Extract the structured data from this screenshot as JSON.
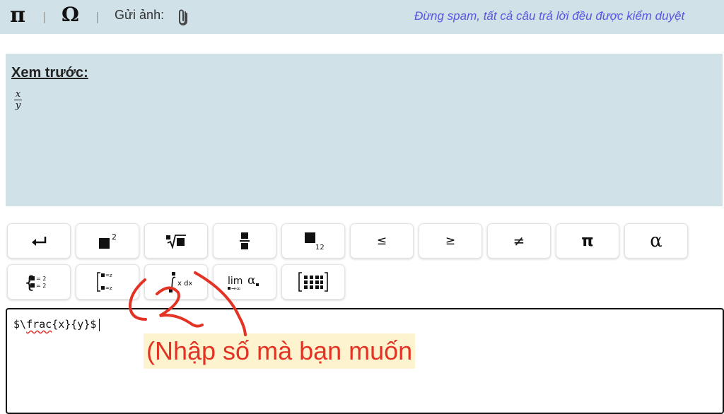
{
  "topbar": {
    "pi_symbol": "π",
    "separator": "|",
    "omega_symbol": "Ω",
    "send_image_label": "Gửi ảnh:",
    "notice": "Đừng spam, tất cả câu trả lời đều được kiểm duyệt"
  },
  "preview": {
    "label": "Xem trước:",
    "numerator": "x",
    "denominator": "y"
  },
  "toolbar": {
    "leq": "≤",
    "geq": "≥",
    "neq": "≠",
    "pi": "π",
    "alpha": "α",
    "lim": "lim",
    "lim_alpha": "α"
  },
  "editor": {
    "prefix": "$\\",
    "command": "frac",
    "suffix": "{x}{y}$"
  },
  "annotation": {
    "text": "(Nhập số mà bạn muốn"
  },
  "colors": {
    "panel_bg": "#d0e1e8",
    "notice_text": "#5b55e0",
    "annotation_red": "#e23325",
    "annotation_bg": "#fdf3cf"
  }
}
